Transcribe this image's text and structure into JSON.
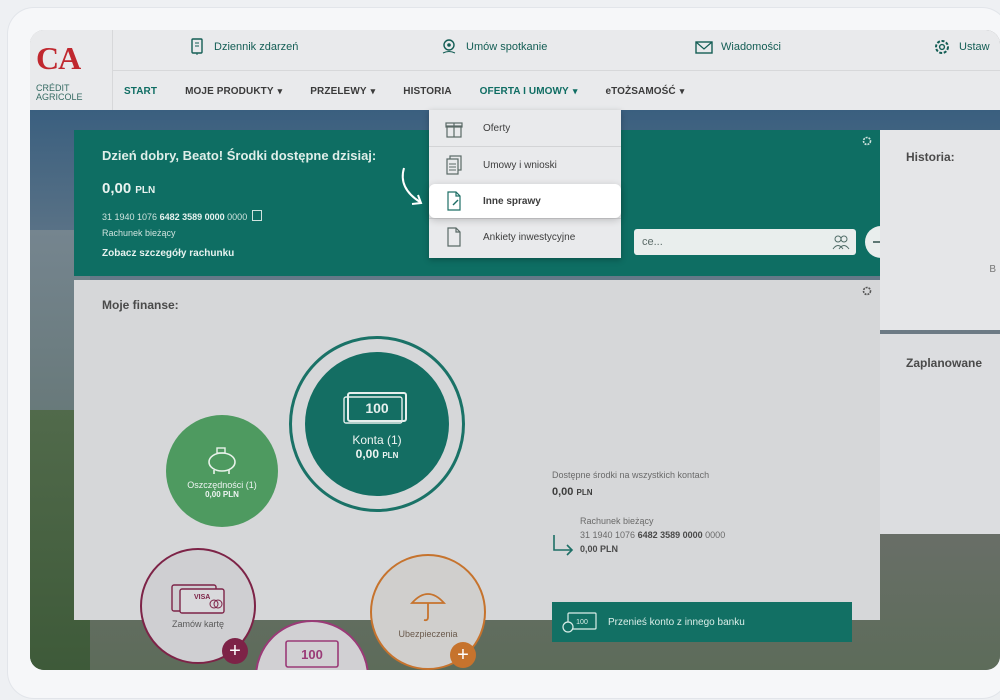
{
  "logo": {
    "mark_ca": "CA",
    "line1": "CRÉDIT",
    "line2": "AGRICOLE"
  },
  "top_actions": {
    "journal": "Dziennik zdarzeń",
    "meeting": "Umów spotkanie",
    "messages": "Wiadomości",
    "settings": "Ustaw"
  },
  "nav": {
    "items": [
      {
        "label": "START"
      },
      {
        "label": "MOJE PRODUKTY",
        "caret": "▾"
      },
      {
        "label": "PRZELEWY",
        "caret": "▾"
      },
      {
        "label": "HISTORIA"
      },
      {
        "label": "OFERTA I UMOWY",
        "caret": "▾"
      },
      {
        "label": "eTOŻSAMOŚĆ",
        "caret": "▾"
      }
    ]
  },
  "dropdown": {
    "items": [
      {
        "label": "Oferty"
      },
      {
        "label": "Umowy i wnioski"
      },
      {
        "label": "Inne sprawy"
      },
      {
        "label": "Ankiety inwestycyjne"
      }
    ]
  },
  "summary": {
    "greeting": "Dzień dobry, Beato! Środki dostępne dzisiaj:",
    "balance": "0,00",
    "currency": "PLN",
    "account_prefix": "31 1940 1076",
    "account_bold": "6482 3589 0000",
    "account_suffix": "0000",
    "account_type": "Rachunek bieżący",
    "details_link": "Zobacz szczegóły rachunku",
    "search_placeholder": "ce..."
  },
  "right": {
    "history_title": "Historia:",
    "history_fragment": "B",
    "planned_title": "Zaplanowane"
  },
  "finance": {
    "title": "Moje finanse:",
    "konta_label": "Konta (1)",
    "konta_value": "0,00",
    "konta_badge": "100",
    "oszcz_label": "Oszczędności (1)",
    "oszcz_value": "0,00",
    "zamow_label": "Zamów kartę",
    "card_brand": "VISA",
    "ubez_label": "Ubezpieczenia",
    "third_badge": "100",
    "available_label": "Dostępne środki na wszystkich kontach",
    "available_value": "0,00",
    "account_type": "Rachunek bieżący",
    "acct_prefix": "31 1940 1076",
    "acct_bold": "6482 3589 0000",
    "acct_suffix": "0000",
    "acct_value": "0,00",
    "transfer_badge": "100",
    "transfer_label": "Przenieś konto z innego banku"
  },
  "colors": {
    "brand_teal": "#0e6e63",
    "brand_red": "#c0282f"
  }
}
